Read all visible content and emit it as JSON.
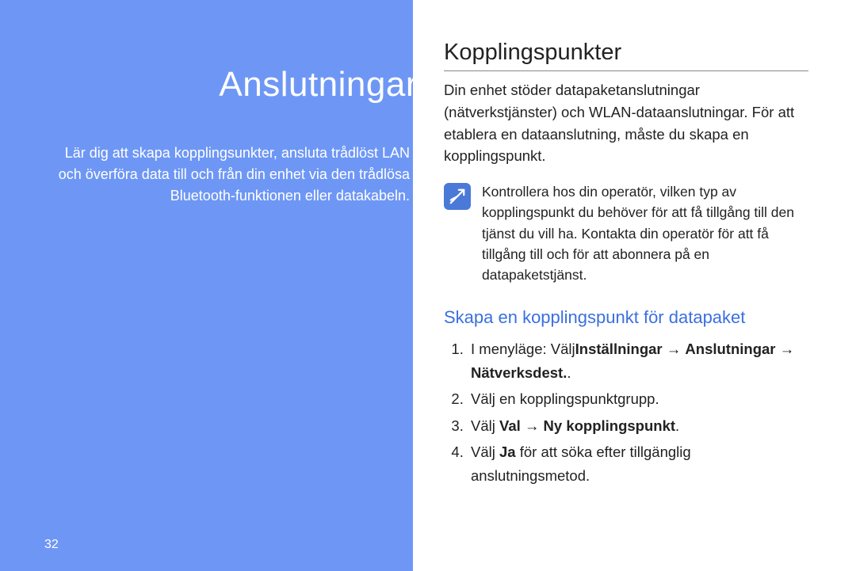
{
  "left": {
    "title": "Anslutningar",
    "description": "Lär dig att skapa kopplingsunkter, ansluta trådlöst LAN och överföra data till och från din enhet via den trådlösa Bluetooth-funktionen eller datakabeln.",
    "page_number": "32"
  },
  "right": {
    "section_title": "Kopplingspunkter",
    "intro": "Din enhet stöder datapaketanslutningar (nätverkstjänster) och WLAN-dataanslutningar. För att etablera en dataanslutning, måste du skapa en kopplingspunkt.",
    "note": "Kontrollera hos din operatör, vilken typ av kopplingspunkt du behöver för att få tillgång till den tjänst du vill ha. Kontakta din operatör för att få tillgång till och för att abonnera på en datapaketstjänst.",
    "sub_heading": "Skapa en kopplingspunkt för datapaket",
    "step1_prefix": "I menyläge: Välj",
    "step1_bold1": "Inställningar",
    "step1_arrow1": " → ",
    "step1_bold2": "Anslutningar",
    "step1_arrow2": " → ",
    "step1_bold3": "Nätverksdest.",
    "step1_suffix": ".",
    "step2": "Välj en kopplingspunktgrupp.",
    "step3_prefix": "Välj ",
    "step3_bold1": "Val",
    "step3_arrow": " → ",
    "step3_bold2": "Ny kopplingspunkt",
    "step3_suffix": ".",
    "step4_prefix": "Välj ",
    "step4_bold": "Ja",
    "step4_suffix": " för att söka efter tillgänglig anslutningsmetod."
  }
}
